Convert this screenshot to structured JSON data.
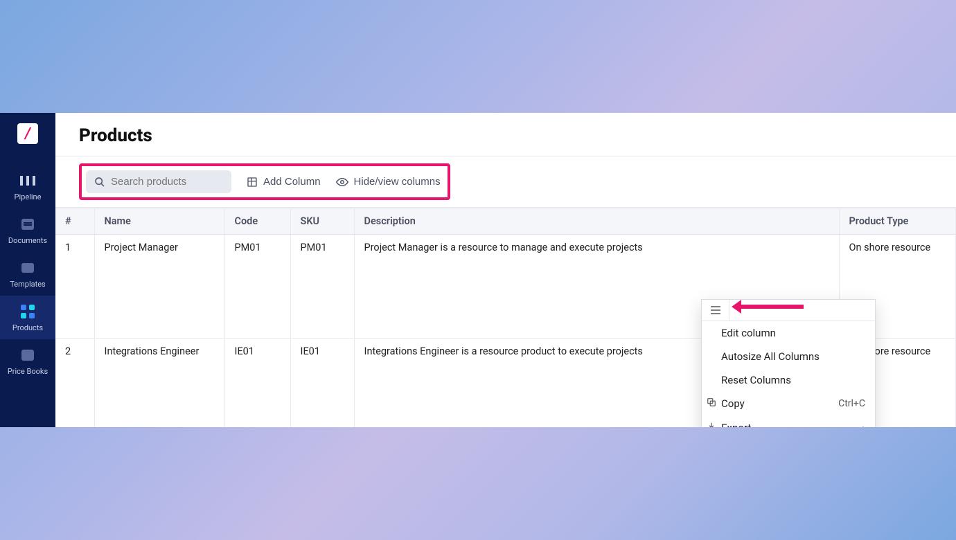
{
  "sidebar": {
    "items": [
      {
        "label": "Pipeline"
      },
      {
        "label": "Documents"
      },
      {
        "label": "Templates"
      },
      {
        "label": "Products"
      },
      {
        "label": "Price Books"
      }
    ],
    "active_index": 3
  },
  "page": {
    "title": "Products"
  },
  "toolbar": {
    "search_placeholder": "Search products",
    "add_column_label": "Add Column",
    "hide_columns_label": "Hide/view columns"
  },
  "table": {
    "columns": [
      "#",
      "Name",
      "Code",
      "SKU",
      "Description",
      "Product Type"
    ],
    "rows": [
      {
        "num": "1",
        "name": "Project Manager",
        "code": "PM01",
        "sku": "PM01",
        "desc": "Project Manager is a resource to manage and execute projects",
        "type": "On shore resource"
      },
      {
        "num": "2",
        "name": "Integrations Engineer",
        "code": "IE01",
        "sku": "IE01",
        "desc": "Integrations Engineer is a resource product to execute projects",
        "type": "On shore resource"
      }
    ]
  },
  "context_menu": {
    "edit_column": "Edit column",
    "autosize": "Autosize All Columns",
    "reset": "Reset Columns",
    "copy": "Copy",
    "copy_kbd": "Ctrl+C",
    "export": "Export"
  }
}
